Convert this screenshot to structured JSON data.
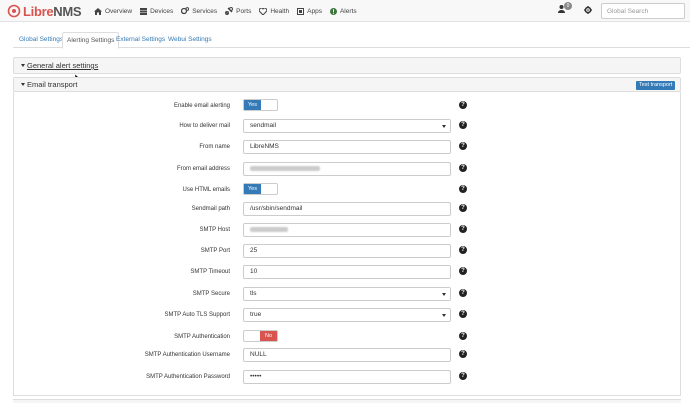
{
  "brand": {
    "part1": "Libre",
    "part2": "NMS"
  },
  "nav": [
    "Overview",
    "Devices",
    "Services",
    "Ports",
    "Health",
    "Apps",
    "Alerts"
  ],
  "user": {
    "badge_count": "0"
  },
  "search": {
    "placeholder": "Global Search"
  },
  "tabs": [
    "Global Settings",
    "Alerting Settings",
    "External Settings",
    "Webui Settings"
  ],
  "sections": {
    "general": "General alert settings",
    "email": "Email transport",
    "test_button": "Test transport"
  },
  "form": {
    "rows": [
      {
        "label": "Enable email alerting",
        "toggle": "Yes"
      },
      {
        "label": "How to deliver mail",
        "value": "sendmail"
      },
      {
        "label": "From name",
        "value": "LibreNMS"
      },
      {
        "label": "From email address",
        "value": ""
      },
      {
        "label": "Use HTML emails",
        "toggle": "Yes"
      },
      {
        "label": "Sendmail path",
        "value": "/usr/sbin/sendmail"
      },
      {
        "label": "SMTP Host",
        "value": ""
      },
      {
        "label": "SMTP Port",
        "value": "25"
      },
      {
        "label": "SMTP Timeout",
        "value": "10"
      },
      {
        "label": "SMTP Secure",
        "value": "tls"
      },
      {
        "label": "SMTP Auto TLS Support",
        "value": "true"
      },
      {
        "label": "SMTP Authentication",
        "toggle": "No"
      },
      {
        "label": "SMTP Authentication Username",
        "value": "NULL"
      },
      {
        "label": "SMTP Authentication Password",
        "value": "•••••"
      }
    ],
    "help_glyph": "?"
  }
}
